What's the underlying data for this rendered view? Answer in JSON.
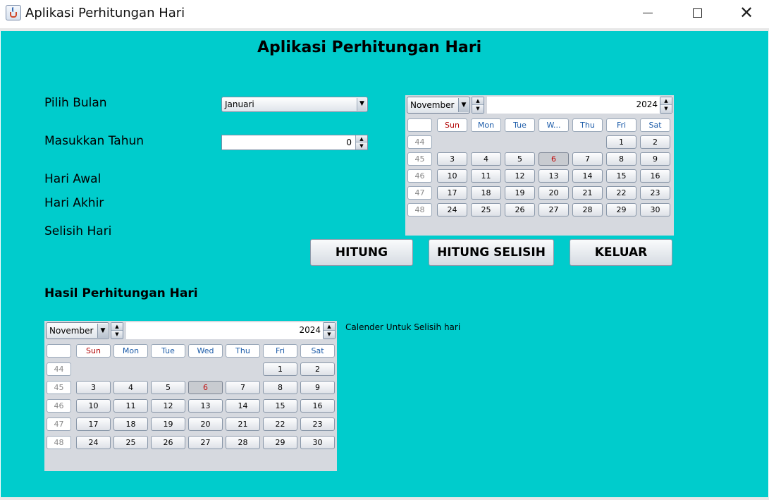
{
  "window": {
    "title": "Aplikasi Perhitungan Hari"
  },
  "heading": "Aplikasi Perhitungan Hari",
  "form": {
    "bulan_label": "Pilih Bulan",
    "bulan_value": "Januari",
    "tahun_label": "Masukkan Tahun",
    "tahun_value": "0",
    "hari_awal_label": "Hari Awal",
    "hari_akhir_label": "Hari Akhir",
    "selisih_label": "Selisih Hari"
  },
  "buttons": {
    "hitung": "HITUNG",
    "hitung_selisih": "HITUNG SELISIH",
    "keluar": "KELUAR"
  },
  "hasil_label": "Hasil Perhitungan Hari",
  "selisih_calendar_caption": "Calender Untuk Selisih hari",
  "calendar_top": {
    "month": "November",
    "year": "2024",
    "weekdays": [
      "Sun",
      "Mon",
      "Tue",
      "W...",
      "Thu",
      "Fri",
      "Sat"
    ],
    "today": "6",
    "weeks": [
      {
        "num": "44",
        "days": [
          "",
          "",
          "",
          "",
          "",
          "1",
          "2"
        ]
      },
      {
        "num": "45",
        "days": [
          "3",
          "4",
          "5",
          "6",
          "7",
          "8",
          "9"
        ]
      },
      {
        "num": "46",
        "days": [
          "10",
          "11",
          "12",
          "13",
          "14",
          "15",
          "16"
        ]
      },
      {
        "num": "47",
        "days": [
          "17",
          "18",
          "19",
          "20",
          "21",
          "22",
          "23"
        ]
      },
      {
        "num": "48",
        "days": [
          "24",
          "25",
          "26",
          "27",
          "28",
          "29",
          "30"
        ]
      }
    ]
  },
  "calendar_bottom": {
    "month": "November",
    "year": "2024",
    "weekdays": [
      "Sun",
      "Mon",
      "Tue",
      "Wed",
      "Thu",
      "Fri",
      "Sat"
    ],
    "today": "6",
    "weeks": [
      {
        "num": "44",
        "days": [
          "",
          "",
          "",
          "",
          "",
          "1",
          "2"
        ]
      },
      {
        "num": "45",
        "days": [
          "3",
          "4",
          "5",
          "6",
          "7",
          "8",
          "9"
        ]
      },
      {
        "num": "46",
        "days": [
          "10",
          "11",
          "12",
          "13",
          "14",
          "15",
          "16"
        ]
      },
      {
        "num": "47",
        "days": [
          "17",
          "18",
          "19",
          "20",
          "21",
          "22",
          "23"
        ]
      },
      {
        "num": "48",
        "days": [
          "24",
          "25",
          "26",
          "27",
          "28",
          "29",
          "30"
        ]
      }
    ]
  }
}
